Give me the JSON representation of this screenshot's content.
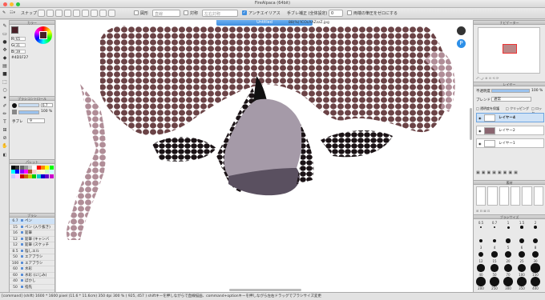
{
  "window": {
    "title": "FireAlpaca (64bit)"
  },
  "toolbar": {
    "snap_label": "スナップ",
    "shape_label": "図形",
    "shape_value": "直線",
    "symmetry_label": "対称",
    "symmetry_value": "左右対称",
    "antialias_label": "アンチエイリアス",
    "stabilizer_label": "手ブレ補正 (全体設定)",
    "stabilizer_value": "0",
    "zero_label": "両端の筆圧をゼロにする"
  },
  "colors": {
    "accent": "#3e8ee0",
    "fg": "#4a1f27",
    "window_bg": "#d6d6d6"
  },
  "color_panel": {
    "title": "カラー",
    "r_label": "R",
    "r_value": "65",
    "g_label": "G",
    "g_value": "31",
    "b_label": "B",
    "b_value": "39",
    "hex": "#4D1F27"
  },
  "brush_control": {
    "title": "ブラシコントロール",
    "size": "6.7",
    "opacity": "100 %",
    "stabilizer_label": "手ブレ",
    "stabilizer": "9"
  },
  "palette": {
    "title": "パレット"
  },
  "brush_list": {
    "title": "ブラシ",
    "items": [
      {
        "size": "6.7",
        "name": "ペン"
      },
      {
        "size": "15",
        "name": "ペン (入り抜き)"
      },
      {
        "size": "16",
        "name": "鉛筆"
      },
      {
        "size": "12",
        "name": "鉛筆 (キャンバ"
      },
      {
        "size": "12",
        "name": "鉛筆 (スケッチ"
      },
      {
        "size": "8.5",
        "name": "陰しエル"
      },
      {
        "size": "50",
        "name": "エアブラシ"
      },
      {
        "size": "100",
        "name": "エアブラシ"
      },
      {
        "size": "60",
        "name": "水彩"
      },
      {
        "size": "60",
        "name": "水彩 (にじみ)"
      },
      {
        "size": "40",
        "name": "ぼかし"
      },
      {
        "size": "50",
        "name": "指先"
      }
    ]
  },
  "canvas": {
    "tab_title": "Untitled",
    "filename": "88(%)'ICOcAAZzzZ.jpg"
  },
  "navigator": {
    "title": "ナビゲーター"
  },
  "layers": {
    "title": "レイヤー",
    "opacity_label": "不透明度",
    "opacity_value": "100 %",
    "blend_label": "ブレンド",
    "blend_value": "通常",
    "protect_label": "透明度を保護",
    "clipping_label": "クリッピング",
    "lock_label": "ロック",
    "items": [
      {
        "name": "レイヤー4"
      },
      {
        "name": "レイヤー2"
      },
      {
        "name": "レイヤー1"
      }
    ]
  },
  "material": {
    "title": "素材"
  },
  "brush_size_panel": {
    "title": "ブラシサイズ",
    "row1": [
      "0.5",
      "0.7",
      "1",
      "1.5",
      "2"
    ],
    "row2": [
      "3",
      "4",
      "5",
      "6",
      "8"
    ],
    "row3": [
      "12",
      "15",
      "20",
      "25",
      "30"
    ],
    "row4": [
      "40",
      "50",
      "70",
      "100",
      "150"
    ],
    "row5": [
      "200",
      "250",
      "300",
      "350",
      "400"
    ]
  },
  "status": {
    "text": "[command] (shift) 1600 * 1600 pixel (11.6 * 11.6cm) 350 dpi 300 % ( 925, 457 ) shiftキーを押しながらで直線描画、command+optionキーを押しながら左右ドラッグでブラシサイズ変更"
  }
}
